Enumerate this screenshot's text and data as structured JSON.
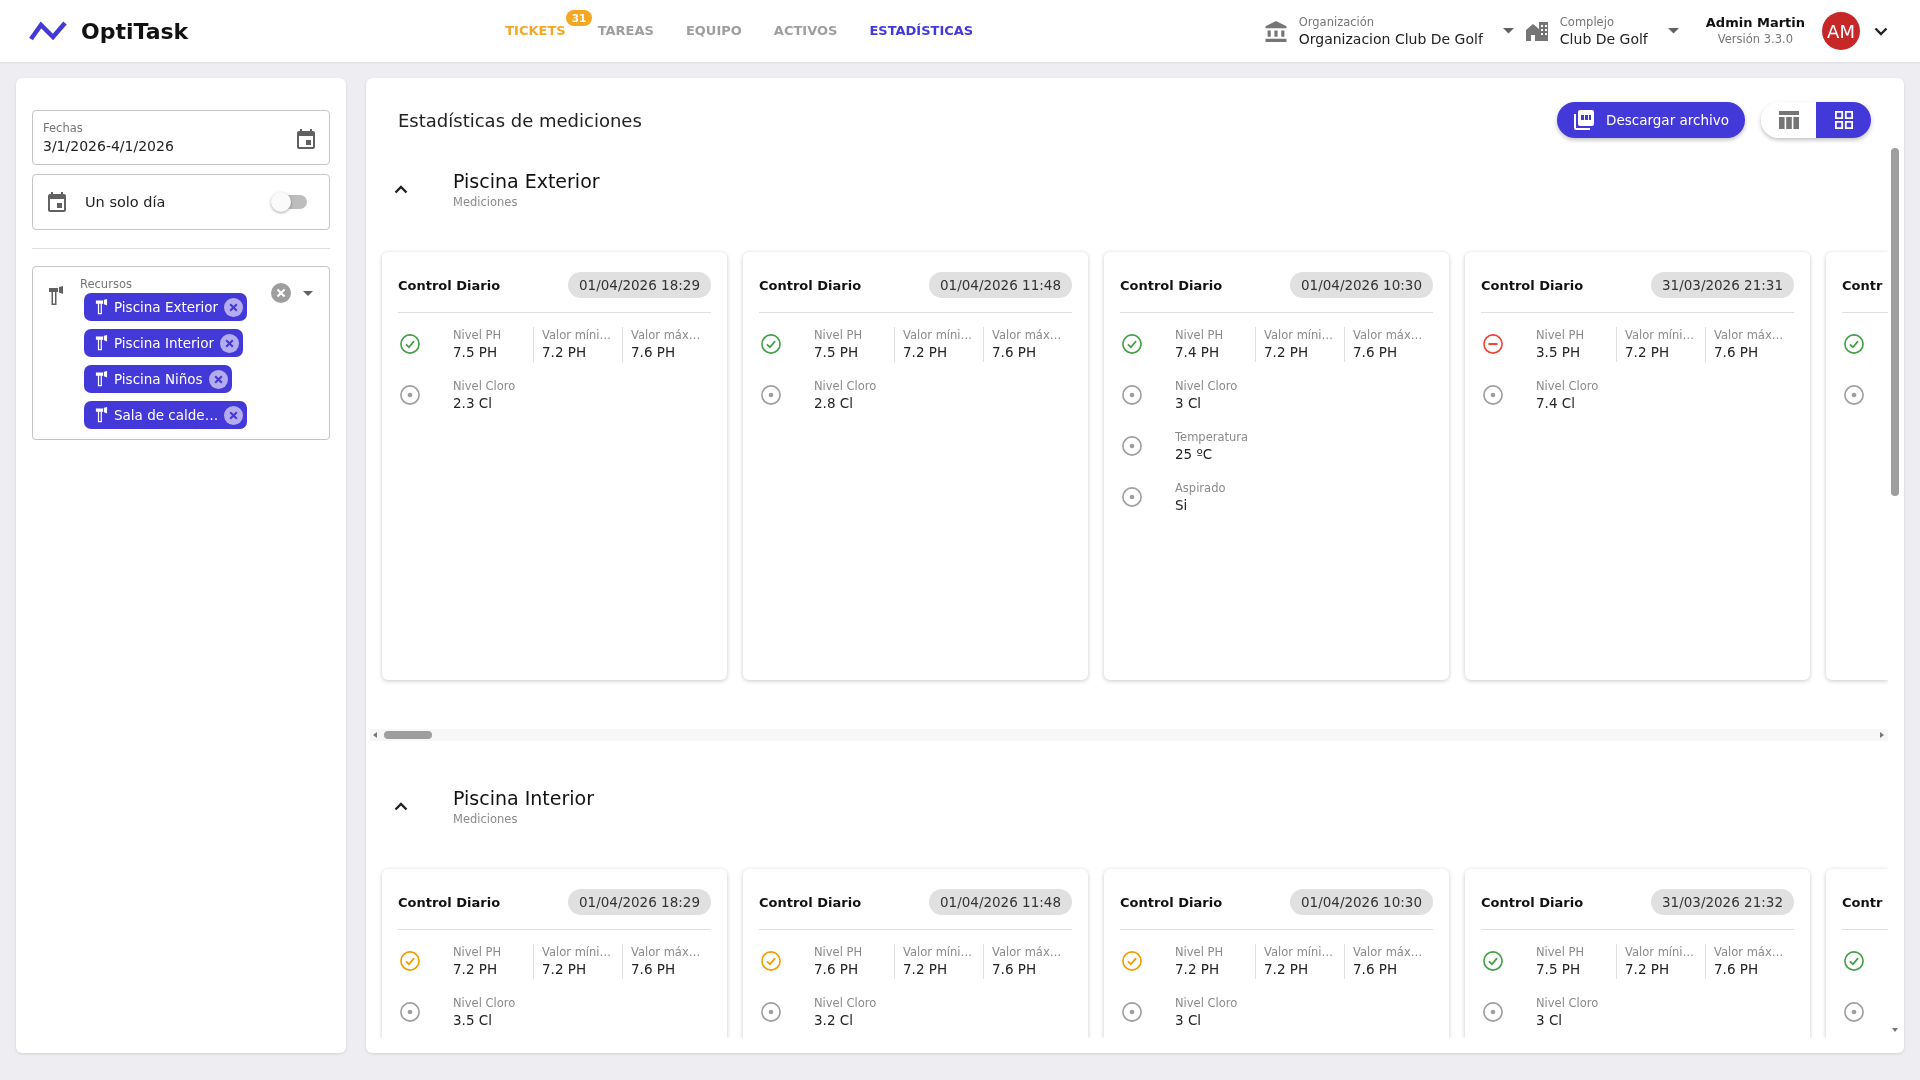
{
  "header": {
    "logo": "OptiTask",
    "nav": [
      {
        "label": "TICKETS",
        "selected": false,
        "highlighted": true,
        "badge": "31"
      },
      {
        "label": "TAREAS",
        "selected": false,
        "highlighted": false
      },
      {
        "label": "EQUIPO",
        "selected": false,
        "highlighted": false
      },
      {
        "label": "ACTIVOS",
        "selected": false,
        "highlighted": false
      },
      {
        "label": "ESTADÍSTICAS",
        "selected": true,
        "highlighted": false
      }
    ],
    "selectors": [
      {
        "kind": "organization",
        "label": "Organización",
        "value": "Organizacion Club De Golf"
      },
      {
        "kind": "complex",
        "label": "Complejo",
        "value": "Club De Golf"
      }
    ],
    "user": {
      "name": "Admin Martin",
      "version": "Versión 3.3.0",
      "initials": "AM"
    }
  },
  "sidebar": {
    "date_field": {
      "label": "Fechas",
      "value": "3/1/2026-4/1/2026"
    },
    "single_day": {
      "label": "Un solo día",
      "on": false
    },
    "resources": {
      "label": "Recursos",
      "chips": [
        "Piscina Exterior",
        "Piscina Interior",
        "Piscina Niños",
        "Sala de calde…"
      ]
    }
  },
  "main": {
    "title": "Estadísticas de mediciones",
    "download_button": "Descargar archivo",
    "view_toggle": [
      {
        "kind": "table",
        "selected": false
      },
      {
        "kind": "grid",
        "selected": true
      }
    ],
    "sections": [
      {
        "title": "Piscina Exterior",
        "subtitle": "Mediciones",
        "expanded": true,
        "cards": [
          {
            "title": "Control Diario",
            "date": "01/04/2026 18:29",
            "rows": [
              {
                "kind": "ok",
                "fields": [
                  {
                    "label": "Nivel PH",
                    "value": "7.5 PH"
                  },
                  {
                    "label": "Valor míni…",
                    "value": "7.2 PH"
                  },
                  {
                    "label": "Valor máx…",
                    "value": "7.6 PH"
                  }
                ]
              },
              {
                "kind": "neutral",
                "fields": [
                  {
                    "label": "Nivel Cloro",
                    "value": "2.3 Cl"
                  }
                ]
              }
            ]
          },
          {
            "title": "Control Diario",
            "date": "01/04/2026 11:48",
            "rows": [
              {
                "kind": "ok",
                "fields": [
                  {
                    "label": "Nivel PH",
                    "value": "7.5 PH"
                  },
                  {
                    "label": "Valor míni…",
                    "value": "7.2 PH"
                  },
                  {
                    "label": "Valor máx…",
                    "value": "7.6 PH"
                  }
                ]
              },
              {
                "kind": "neutral",
                "fields": [
                  {
                    "label": "Nivel Cloro",
                    "value": "2.8 Cl"
                  }
                ]
              }
            ]
          },
          {
            "title": "Control Diario",
            "date": "01/04/2026 10:30",
            "rows": [
              {
                "kind": "ok",
                "fields": [
                  {
                    "label": "Nivel PH",
                    "value": "7.4 PH"
                  },
                  {
                    "label": "Valor míni…",
                    "value": "7.2 PH"
                  },
                  {
                    "label": "Valor máx…",
                    "value": "7.6 PH"
                  }
                ]
              },
              {
                "kind": "neutral",
                "fields": [
                  {
                    "label": "Nivel Cloro",
                    "value": "3 Cl"
                  }
                ]
              },
              {
                "kind": "neutral",
                "fields": [
                  {
                    "label": "Temperatura",
                    "value": "25 ºC"
                  }
                ]
              },
              {
                "kind": "neutral",
                "fields": [
                  {
                    "label": "Aspirado",
                    "value": "Si"
                  }
                ]
              }
            ]
          },
          {
            "title": "Control Diario",
            "date": "31/03/2026 21:31",
            "rows": [
              {
                "kind": "error",
                "fields": [
                  {
                    "label": "Nivel PH",
                    "value": "3.5 PH"
                  },
                  {
                    "label": "Valor míni…",
                    "value": "7.2 PH"
                  },
                  {
                    "label": "Valor máx…",
                    "value": "7.6 PH"
                  }
                ]
              },
              {
                "kind": "neutral",
                "fields": [
                  {
                    "label": "Nivel Cloro",
                    "value": "7.4 Cl"
                  }
                ]
              }
            ]
          },
          {
            "title": "Contr",
            "rows": [
              {
                "kind": "ok"
              },
              {
                "kind": "neutral"
              }
            ]
          }
        ]
      },
      {
        "title": "Piscina Interior",
        "subtitle": "Mediciones",
        "expanded": true,
        "cards": [
          {
            "title": "Control Diario",
            "date": "01/04/2026 18:29",
            "rows": [
              {
                "kind": "warning",
                "fields": [
                  {
                    "label": "Nivel PH",
                    "value": "7.2 PH"
                  },
                  {
                    "label": "Valor míni…",
                    "value": "7.2 PH"
                  },
                  {
                    "label": "Valor máx…",
                    "value": "7.6 PH"
                  }
                ]
              },
              {
                "kind": "neutral",
                "fields": [
                  {
                    "label": "Nivel Cloro",
                    "value": "3.5 Cl"
                  }
                ]
              }
            ]
          },
          {
            "title": "Control Diario",
            "date": "01/04/2026 11:48",
            "rows": [
              {
                "kind": "warning",
                "fields": [
                  {
                    "label": "Nivel PH",
                    "value": "7.6 PH"
                  },
                  {
                    "label": "Valor míni…",
                    "value": "7.2 PH"
                  },
                  {
                    "label": "Valor máx…",
                    "value": "7.6 PH"
                  }
                ]
              },
              {
                "kind": "neutral",
                "fields": [
                  {
                    "label": "Nivel Cloro",
                    "value": "3.2 Cl"
                  }
                ]
              }
            ]
          },
          {
            "title": "Control Diario",
            "date": "01/04/2026 10:30",
            "rows": [
              {
                "kind": "warning",
                "fields": [
                  {
                    "label": "Nivel PH",
                    "value": "7.2 PH"
                  },
                  {
                    "label": "Valor míni…",
                    "value": "7.2 PH"
                  },
                  {
                    "label": "Valor máx…",
                    "value": "7.6 PH"
                  }
                ]
              },
              {
                "kind": "neutral",
                "fields": [
                  {
                    "label": "Nivel Cloro",
                    "value": "3 Cl"
                  }
                ]
              }
            ]
          },
          {
            "title": "Control Diario",
            "date": "31/03/2026 21:32",
            "rows": [
              {
                "kind": "ok",
                "fields": [
                  {
                    "label": "Nivel PH",
                    "value": "7.5 PH"
                  },
                  {
                    "label": "Valor míni…",
                    "value": "7.2 PH"
                  },
                  {
                    "label": "Valor máx…",
                    "value": "7.6 PH"
                  }
                ]
              },
              {
                "kind": "neutral",
                "fields": [
                  {
                    "label": "Nivel Cloro",
                    "value": "3 Cl"
                  }
                ]
              }
            ]
          },
          {
            "title": "Contr",
            "rows": [
              {
                "kind": "ok"
              },
              {
                "kind": "neutral"
              }
            ]
          }
        ]
      }
    ]
  }
}
